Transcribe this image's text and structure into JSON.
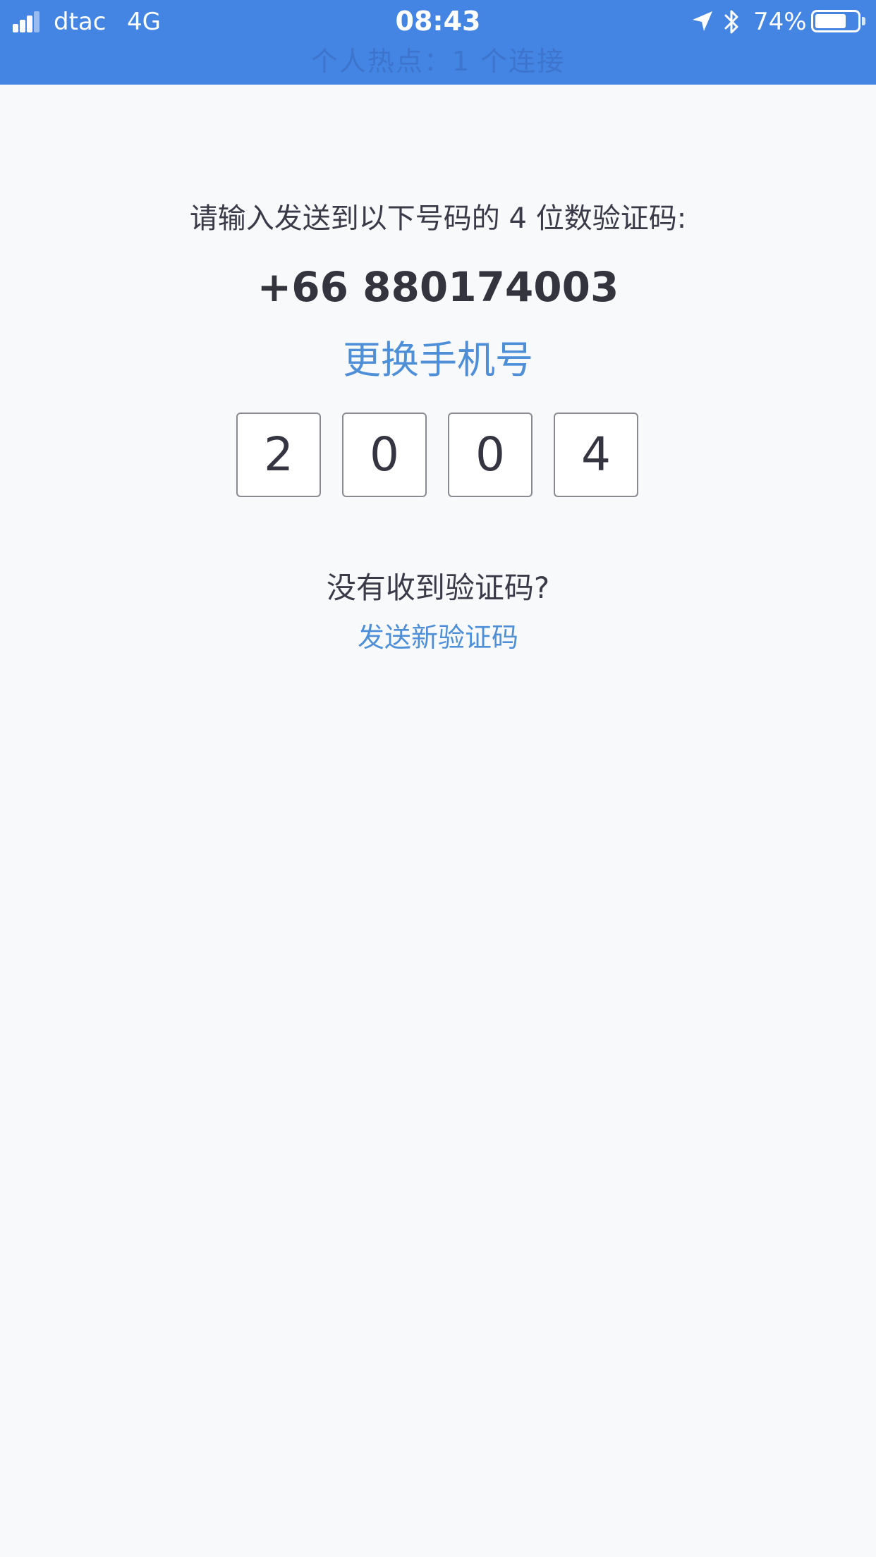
{
  "status_bar": {
    "carrier": "dtac",
    "network": "4G",
    "time": "08:43",
    "battery_percent": "74%",
    "battery_level": 0.74,
    "hotspot_text": "个人热点：1 个连接",
    "background_color": "#4485e3"
  },
  "verification": {
    "prompt": "请输入发送到以下号码的 4 位数验证码:",
    "phone_number": "+66 880174003",
    "change_number_label": "更换手机号",
    "code_digits": [
      "2",
      "0",
      "0",
      "4"
    ]
  },
  "resend": {
    "question": "没有收到验证码?",
    "link_label": "发送新验证码"
  },
  "colors": {
    "accent": "#4e8fd8",
    "text": "#3a3a48",
    "background": "#f8f9fb"
  }
}
